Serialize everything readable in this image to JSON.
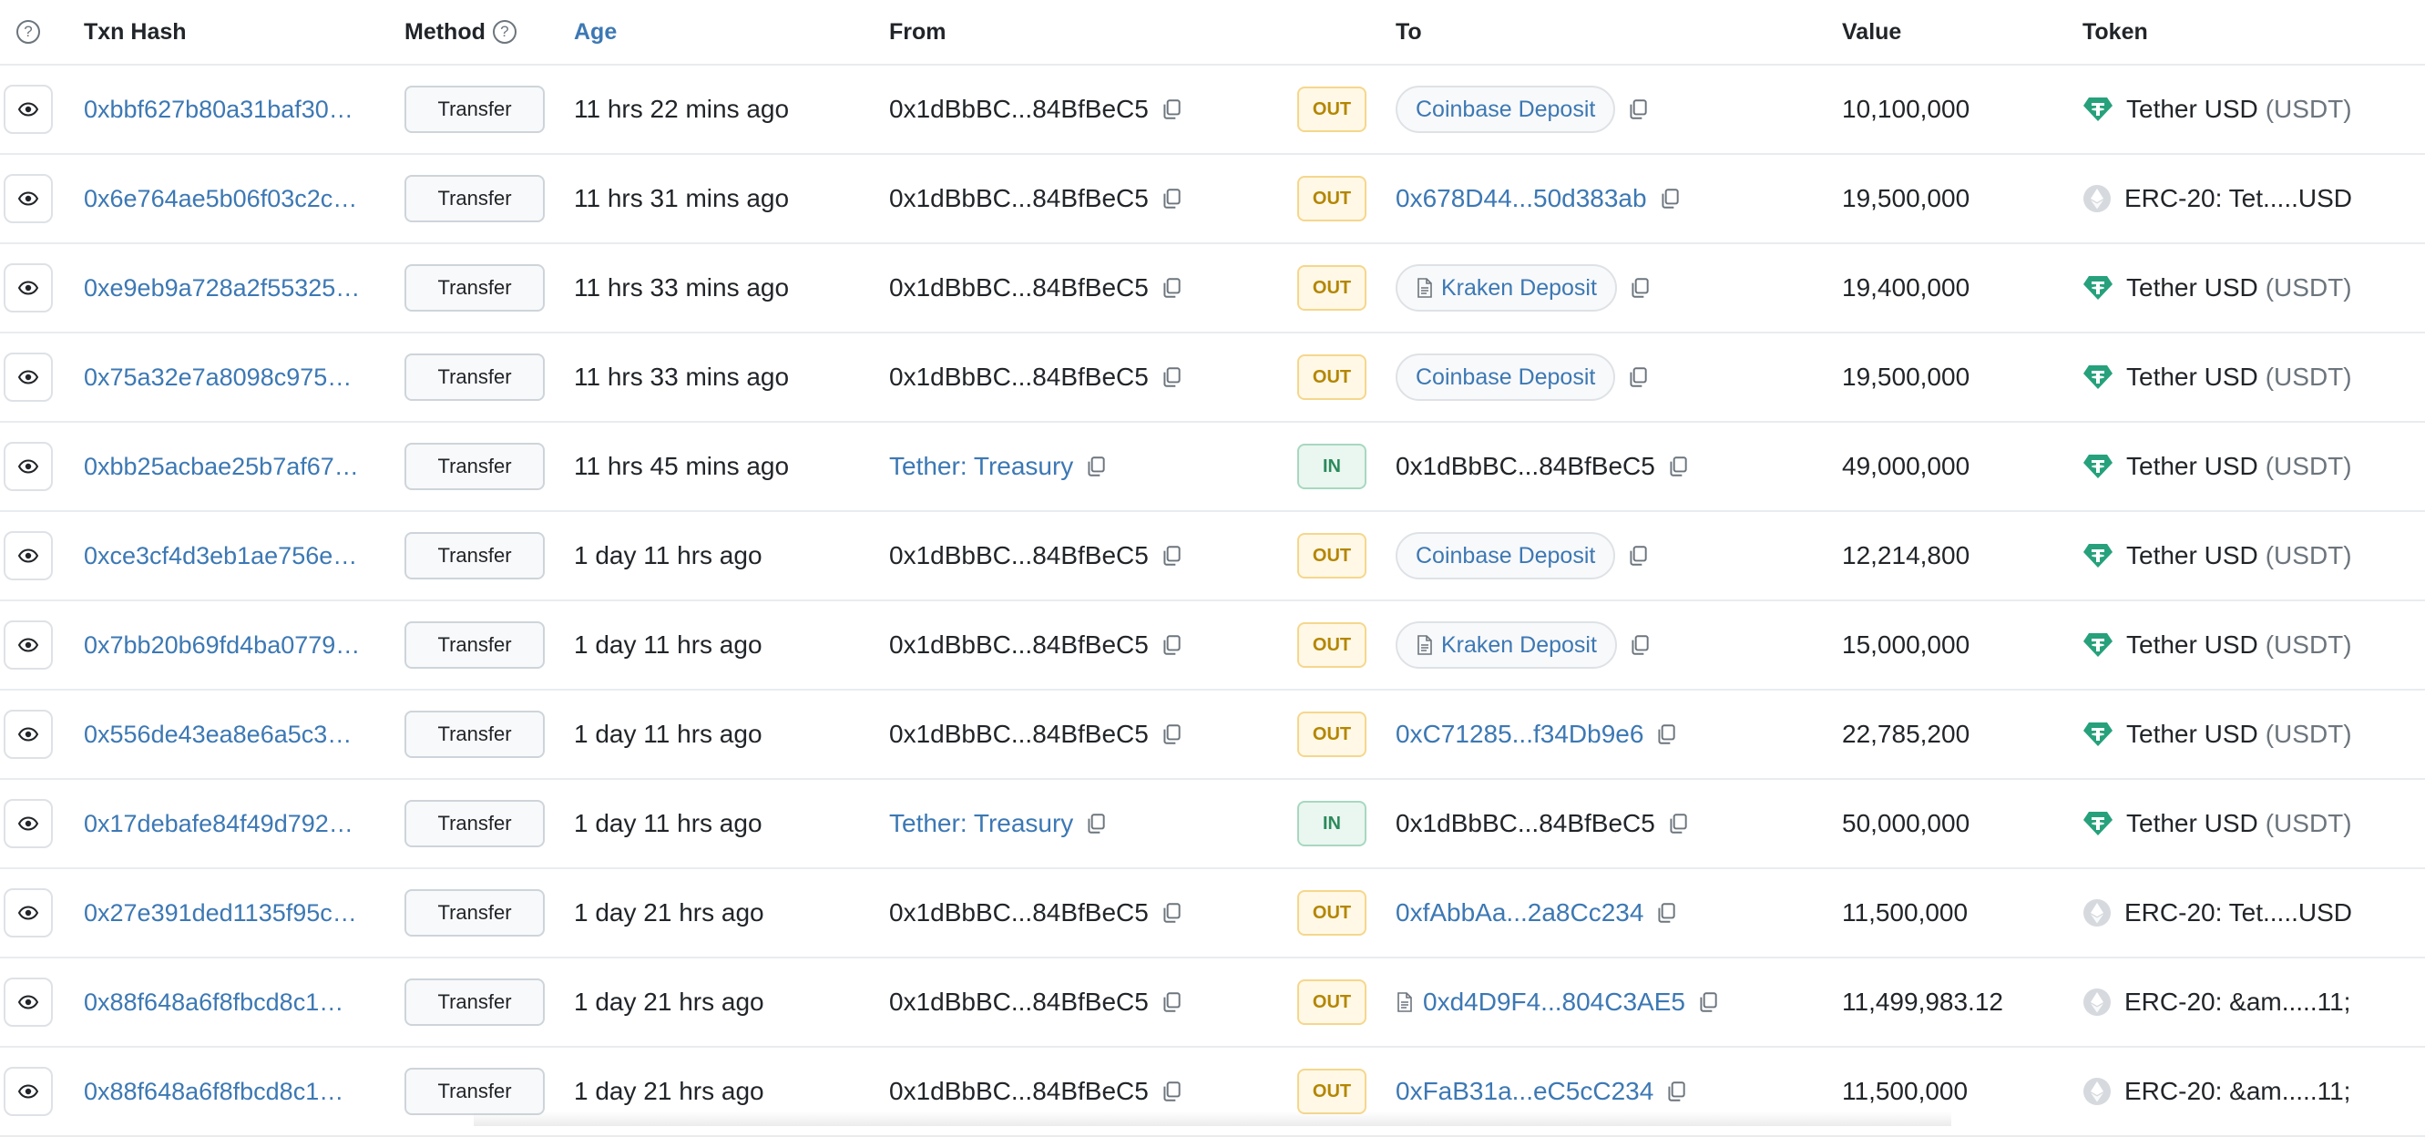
{
  "headers": {
    "txn_hash": "Txn Hash",
    "method": "Method",
    "age": "Age",
    "from": "From",
    "to": "To",
    "value": "Value",
    "token": "Token",
    "help": "?"
  },
  "colors": {
    "link": "#3c78b4",
    "out_badge": "#b38600",
    "in_badge": "#2c8a5c",
    "tether": "#26a17b"
  },
  "rows": [
    {
      "hash": "0xbbf627b80a31baf30…",
      "method": "Transfer",
      "age": "11 hrs 22 mins ago",
      "from": "0x1dBbBC...84BfBeC5",
      "from_link": false,
      "dir": "OUT",
      "to": "Coinbase Deposit",
      "to_type": "pill",
      "value": "10,100,000",
      "token": "Tether USD",
      "token_sym": "(USDT)",
      "token_icon": "tether-icon"
    },
    {
      "hash": "0x6e764ae5b06f03c2c…",
      "method": "Transfer",
      "age": "11 hrs 31 mins ago",
      "from": "0x1dBbBC...84BfBeC5",
      "from_link": false,
      "dir": "OUT",
      "to": "0x678D44...50d383ab",
      "to_type": "link",
      "value": "19,500,000",
      "token": "ERC-20: Tet.....USD",
      "token_sym": "",
      "token_icon": "eth-icon"
    },
    {
      "hash": "0xe9eb9a728a2f55325…",
      "method": "Transfer",
      "age": "11 hrs 33 mins ago",
      "from": "0x1dBbBC...84BfBeC5",
      "from_link": false,
      "dir": "OUT",
      "to": "Kraken Deposit",
      "to_type": "pill-doc",
      "value": "19,400,000",
      "token": "Tether USD",
      "token_sym": "(USDT)",
      "token_icon": "tether-icon"
    },
    {
      "hash": "0x75a32e7a8098c975…",
      "method": "Transfer",
      "age": "11 hrs 33 mins ago",
      "from": "0x1dBbBC...84BfBeC5",
      "from_link": false,
      "dir": "OUT",
      "to": "Coinbase Deposit",
      "to_type": "pill",
      "value": "19,500,000",
      "token": "Tether USD",
      "token_sym": "(USDT)",
      "token_icon": "tether-icon"
    },
    {
      "hash": "0xbb25acbae25b7af67…",
      "method": "Transfer",
      "age": "11 hrs 45 mins ago",
      "from": "Tether: Treasury",
      "from_link": true,
      "dir": "IN",
      "to": "0x1dBbBC...84BfBeC5",
      "to_type": "plain",
      "value": "49,000,000",
      "token": "Tether USD",
      "token_sym": "(USDT)",
      "token_icon": "tether-icon"
    },
    {
      "hash": "0xce3cf4d3eb1ae756e…",
      "method": "Transfer",
      "age": "1 day 11 hrs ago",
      "from": "0x1dBbBC...84BfBeC5",
      "from_link": false,
      "dir": "OUT",
      "to": "Coinbase Deposit",
      "to_type": "pill",
      "value": "12,214,800",
      "token": "Tether USD",
      "token_sym": "(USDT)",
      "token_icon": "tether-icon"
    },
    {
      "hash": "0x7bb20b69fd4ba0779…",
      "method": "Transfer",
      "age": "1 day 11 hrs ago",
      "from": "0x1dBbBC...84BfBeC5",
      "from_link": false,
      "dir": "OUT",
      "to": "Kraken Deposit",
      "to_type": "pill-doc",
      "value": "15,000,000",
      "token": "Tether USD",
      "token_sym": "(USDT)",
      "token_icon": "tether-icon"
    },
    {
      "hash": "0x556de43ea8e6a5c3…",
      "method": "Transfer",
      "age": "1 day 11 hrs ago",
      "from": "0x1dBbBC...84BfBeC5",
      "from_link": false,
      "dir": "OUT",
      "to": "0xC71285...f34Db9e6",
      "to_type": "link",
      "value": "22,785,200",
      "token": "Tether USD",
      "token_sym": "(USDT)",
      "token_icon": "tether-icon"
    },
    {
      "hash": "0x17debafe84f49d792…",
      "method": "Transfer",
      "age": "1 day 11 hrs ago",
      "from": "Tether: Treasury",
      "from_link": true,
      "dir": "IN",
      "to": "0x1dBbBC...84BfBeC5",
      "to_type": "plain",
      "value": "50,000,000",
      "token": "Tether USD",
      "token_sym": "(USDT)",
      "token_icon": "tether-icon"
    },
    {
      "hash": "0x27e391ded1135f95c…",
      "method": "Transfer",
      "age": "1 day 21 hrs ago",
      "from": "0x1dBbBC...84BfBeC5",
      "from_link": false,
      "dir": "OUT",
      "to": "0xfAbbAa...2a8Cc234",
      "to_type": "link",
      "value": "11,500,000",
      "token": "ERC-20: Tet.....USD",
      "token_sym": "",
      "token_icon": "eth-icon"
    },
    {
      "hash": "0x88f648a6f8fbcd8c1…",
      "method": "Transfer",
      "age": "1 day 21 hrs ago",
      "from": "0x1dBbBC...84BfBeC5",
      "from_link": false,
      "dir": "OUT",
      "to": "0xd4D9F4...804C3AE5",
      "to_type": "link-doc",
      "value": "11,499,983.12",
      "token": "ERC-20: &am.....11;",
      "token_sym": "",
      "token_icon": "eth-icon"
    },
    {
      "hash": "0x88f648a6f8fbcd8c1…",
      "method": "Transfer",
      "age": "1 day 21 hrs ago",
      "from": "0x1dBbBC...84BfBeC5",
      "from_link": false,
      "dir": "OUT",
      "to": "0xFaB31a...eC5cC234",
      "to_type": "link",
      "value": "11,500,000",
      "token": "ERC-20: &am.....11;",
      "token_sym": "",
      "token_icon": "eth-icon"
    }
  ]
}
